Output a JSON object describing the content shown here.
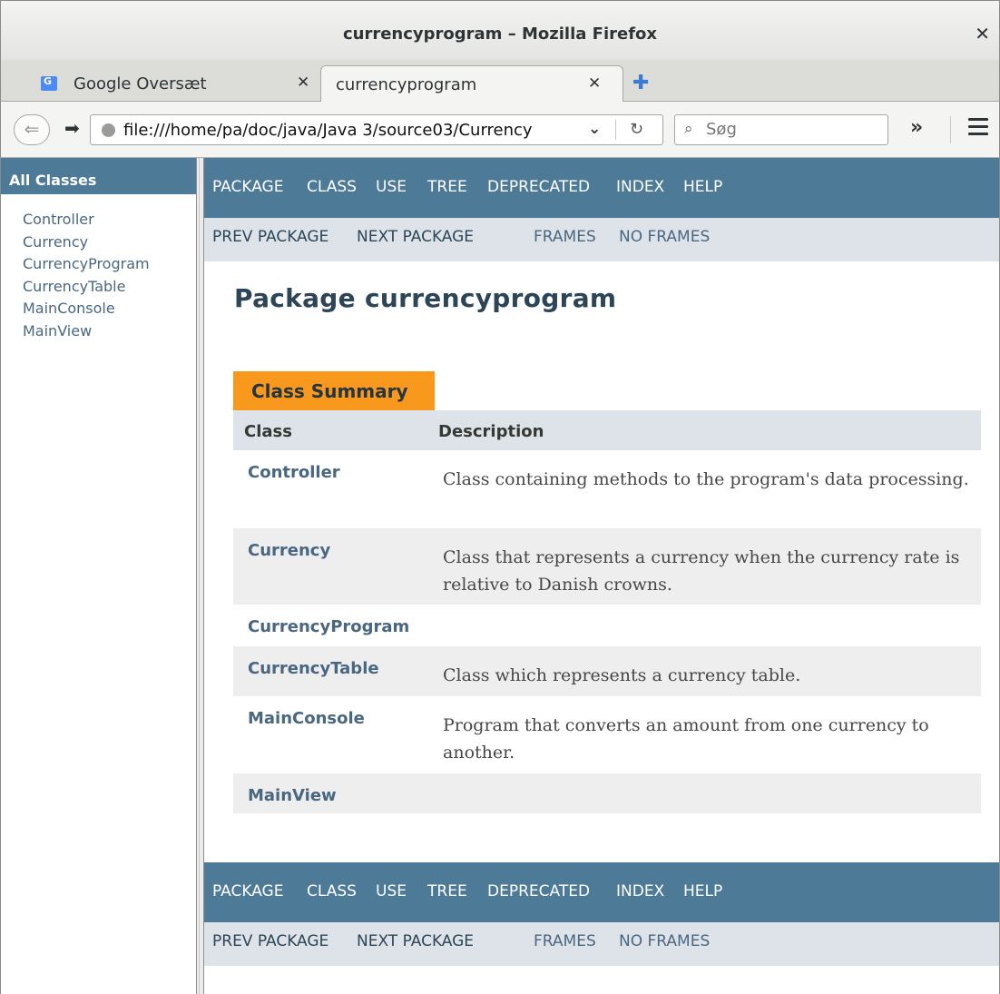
{
  "window": {
    "title": "currencyprogram – Mozilla Firefox"
  },
  "tabs": [
    {
      "label": "Google Oversæt",
      "favicon": "google-translate-icon"
    },
    {
      "label": "currencyprogram"
    }
  ],
  "navbar": {
    "url": "file:///home/pa/doc/java/Java 3/source03/Currency",
    "search_placeholder": "Søg"
  },
  "left_frame": {
    "heading": "All Classes",
    "classes": [
      "Controller",
      "Currency",
      "CurrencyProgram",
      "CurrencyTable",
      "MainConsole",
      "MainView"
    ]
  },
  "nav": {
    "package": "PACKAGE",
    "class": "CLASS",
    "use": "USE",
    "tree": "TREE",
    "deprecated": "DEPRECATED",
    "index": "INDEX",
    "help": "HELP",
    "prev_package": "PREV PACKAGE",
    "next_package": "NEXT PACKAGE",
    "frames": "FRAMES",
    "no_frames": "NO FRAMES"
  },
  "page": {
    "title": "Package currencyprogram",
    "summary_tab": "Class Summary",
    "col_class": "Class",
    "col_description": "Description",
    "rows": [
      {
        "name": "Controller",
        "description": "Class containing methods to the program's data processing."
      },
      {
        "name": "Currency",
        "description": "Class that represents a currency when the currency rate is relative to Danish crowns."
      },
      {
        "name": "CurrencyProgram",
        "description": ""
      },
      {
        "name": "CurrencyTable",
        "description": "Class which represents a currency table."
      },
      {
        "name": "MainConsole",
        "description": "Program that converts an amount from one currency to another."
      },
      {
        "name": "MainView",
        "description": ""
      }
    ]
  },
  "colors": {
    "nav_bar": "#4d7a97",
    "sub_nav": "#dee3e9",
    "summary_tab": "#f8981d",
    "link": "#4a6782",
    "title": "#2c4557"
  }
}
